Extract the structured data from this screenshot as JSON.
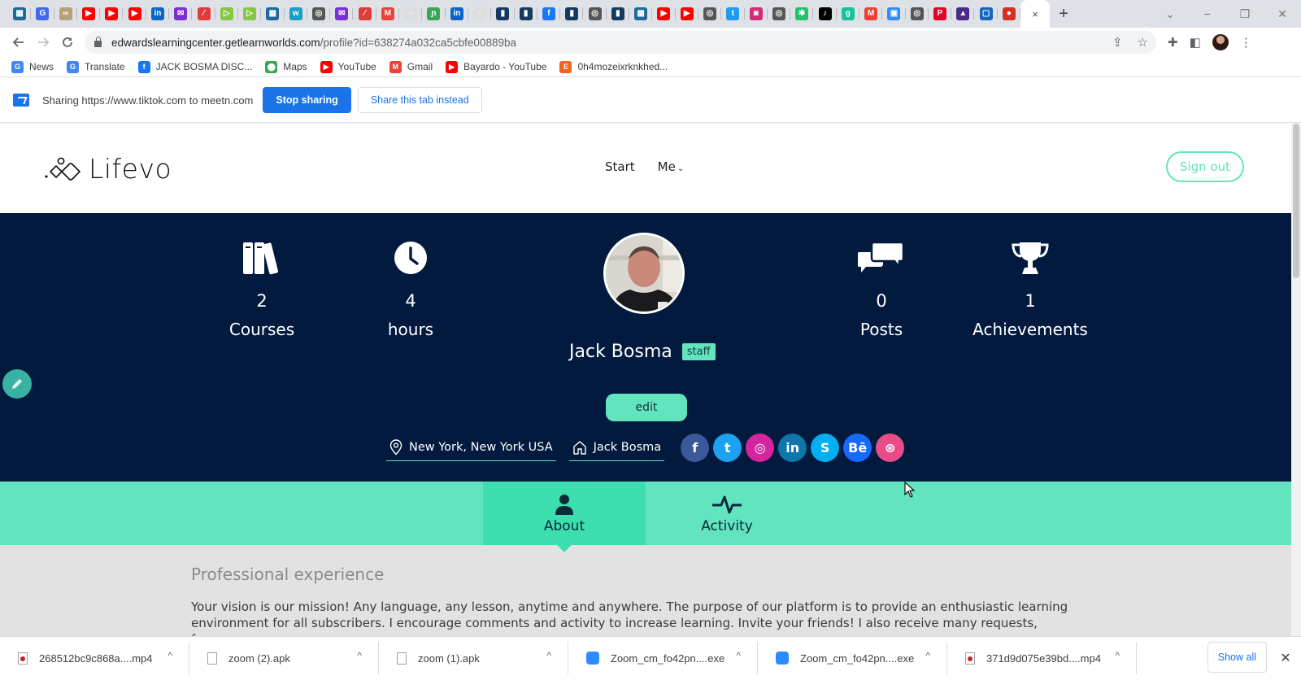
{
  "browser": {
    "tabs": [
      {
        "icon": "meetn-icon",
        "color": "#1a6a9a",
        "glyph": "▦"
      },
      {
        "icon": "google-icon",
        "color": "#4467f0",
        "glyph": "G"
      },
      {
        "icon": "link-icon",
        "color": "#b7a07a",
        "glyph": "∞"
      },
      {
        "icon": "youtube-icon",
        "color": "#ff0000",
        "glyph": "▶"
      },
      {
        "icon": "youtube-icon",
        "color": "#ff0000",
        "glyph": "▶"
      },
      {
        "icon": "youtube-icon",
        "color": "#ff0000",
        "glyph": "▶"
      },
      {
        "icon": "linkedin-icon",
        "color": "#0a66c2",
        "glyph": "in"
      },
      {
        "icon": "mail-icon",
        "color": "#7b2fd0",
        "glyph": "✉"
      },
      {
        "icon": "pen-icon",
        "color": "#e03a3a",
        "glyph": "⁄"
      },
      {
        "icon": "rumble-icon",
        "color": "#85c742",
        "glyph": "▷"
      },
      {
        "icon": "rumble-icon",
        "color": "#85c742",
        "glyph": "▷"
      },
      {
        "icon": "meetn-icon",
        "color": "#1a6a9a",
        "glyph": "▦"
      },
      {
        "icon": "w-icon",
        "color": "#17a0c4",
        "glyph": "w"
      },
      {
        "icon": "chrome-icon",
        "color": "#555555",
        "glyph": "◎"
      },
      {
        "icon": "mail-icon",
        "color": "#7b2fd0",
        "glyph": "✉"
      },
      {
        "icon": "pen-icon",
        "color": "#e03a3a",
        "glyph": "⁄"
      },
      {
        "icon": "gmail-icon",
        "color": "#ea4335",
        "glyph": "M"
      },
      {
        "icon": "blank-icon",
        "color": "#dddddd",
        "glyph": "○"
      },
      {
        "icon": "stripe-icon",
        "color": "#3aa757",
        "glyph": "ɲ"
      },
      {
        "icon": "linkedin-icon",
        "color": "#0a66c2",
        "glyph": "in"
      },
      {
        "icon": "blank-icon",
        "color": "#dddddd",
        "glyph": "○"
      },
      {
        "icon": "dark-app-icon",
        "color": "#163a5f",
        "glyph": "▮"
      },
      {
        "icon": "dark-app-icon",
        "color": "#163a5f",
        "glyph": "▮"
      },
      {
        "icon": "facebook-icon",
        "color": "#1877f2",
        "glyph": "f"
      },
      {
        "icon": "dark-app-icon",
        "color": "#163a5f",
        "glyph": "▮"
      },
      {
        "icon": "chrome-icon",
        "color": "#555555",
        "glyph": "◎"
      },
      {
        "icon": "dark-app-icon",
        "color": "#163a5f",
        "glyph": "▮"
      },
      {
        "icon": "meetn-icon",
        "color": "#1a6a9a",
        "glyph": "▦"
      },
      {
        "icon": "youtube-icon",
        "color": "#ff0000",
        "glyph": "▶"
      },
      {
        "icon": "youtube-icon",
        "color": "#ff0000",
        "glyph": "▶"
      },
      {
        "icon": "chrome-icon",
        "color": "#555555",
        "glyph": "◎"
      },
      {
        "icon": "twitter-icon",
        "color": "#1d9bf0",
        "glyph": "t"
      },
      {
        "icon": "instagram-icon",
        "color": "#d62976",
        "glyph": "◙"
      },
      {
        "icon": "chrome-icon",
        "color": "#555555",
        "glyph": "◎"
      },
      {
        "icon": "asterisk-icon",
        "color": "#23c16b",
        "glyph": "✱"
      },
      {
        "icon": "tiktok-icon",
        "color": "#000000",
        "glyph": "♪"
      },
      {
        "icon": "g-icon",
        "color": "#15c39a",
        "glyph": "g"
      },
      {
        "icon": "gmail-icon",
        "color": "#ea4335",
        "glyph": "M"
      },
      {
        "icon": "zoom-icon",
        "color": "#2d8cff",
        "glyph": "▣"
      },
      {
        "icon": "chrome-icon",
        "color": "#555555",
        "glyph": "◎"
      },
      {
        "icon": "pinterest-icon",
        "color": "#e60023",
        "glyph": "P"
      },
      {
        "icon": "chart-app-icon",
        "color": "#4b2a8a",
        "glyph": "▲"
      },
      {
        "icon": "window-icon",
        "color": "#1565c0",
        "glyph": "▢"
      },
      {
        "icon": "record-icon",
        "color": "#d93025",
        "glyph": "●"
      }
    ],
    "active_tab_close": "×",
    "new_tab": "+",
    "window_controls": {
      "tab_search": "⌄",
      "minimize": "−",
      "restore": "❐",
      "close": "✕"
    },
    "address": {
      "host": "edwardslearningcenter.getlearnworlds.com",
      "path": "/profile?id=638274a032ca5cbfe00889ba"
    },
    "bookmarks": [
      {
        "label": "News",
        "icon": "google-news-icon",
        "color": "#4285f4",
        "glyph": "G"
      },
      {
        "label": "Translate",
        "icon": "google-translate-icon",
        "color": "#4285f4",
        "glyph": "G"
      },
      {
        "label": "JACK BOSMA DISC...",
        "icon": "facebook-icon",
        "color": "#1877f2",
        "glyph": "f"
      },
      {
        "label": "Maps",
        "icon": "maps-icon",
        "color": "#34a853",
        "glyph": "⬤"
      },
      {
        "label": "YouTube",
        "icon": "youtube-icon",
        "color": "#ff0000",
        "glyph": "▶"
      },
      {
        "label": "Gmail",
        "icon": "gmail-icon",
        "color": "#ea4335",
        "glyph": "M"
      },
      {
        "label": "Bayardo - YouTube",
        "icon": "youtube-icon",
        "color": "#ff0000",
        "glyph": "▶"
      },
      {
        "label": "0h4mozeixrknkhed...",
        "icon": "etsy-icon",
        "color": "#f1641e",
        "glyph": "E"
      }
    ],
    "sharing": {
      "text": "Sharing https://www.tiktok.com to meetn.com",
      "stop_label": "Stop sharing",
      "share_tab_label": "Share this tab instead"
    }
  },
  "site": {
    "logo_text": "Lifevo",
    "nav": {
      "start": "Start",
      "me": "Me"
    },
    "sign_out": "Sign out",
    "colors": {
      "accent": "#62e4be",
      "accent_dark": "#3ddfae",
      "hero_bg": "#021a3e"
    }
  },
  "profile": {
    "stats": [
      {
        "icon": "books-icon",
        "value": "2",
        "label": "Courses"
      },
      {
        "icon": "clock-icon",
        "value": "4",
        "label": "hours"
      },
      {
        "icon": "comments-icon",
        "value": "0",
        "label": "Posts"
      },
      {
        "icon": "trophy-icon",
        "value": "1",
        "label": "Achievements"
      }
    ],
    "name": "Jack Bosma",
    "badge": "staff",
    "edit_label": "edit",
    "location": "New York, New York USA",
    "home": "Jack Bosma",
    "socials": [
      {
        "name": "facebook",
        "color": "#3b5998",
        "glyph": "f"
      },
      {
        "name": "twitter",
        "color": "#1da1f2",
        "glyph": "t"
      },
      {
        "name": "instagram",
        "color": "#d6249f",
        "glyph": "◎"
      },
      {
        "name": "linkedin",
        "color": "#0e76a8",
        "glyph": "in"
      },
      {
        "name": "skype",
        "color": "#00aff0",
        "glyph": "S"
      },
      {
        "name": "behance",
        "color": "#1769ff",
        "glyph": "Bē"
      },
      {
        "name": "dribbble",
        "color": "#ea4c89",
        "glyph": "⊛"
      }
    ],
    "tabs": [
      {
        "label": "About",
        "icon": "user-icon",
        "active": true
      },
      {
        "label": "Activity",
        "icon": "activity-icon",
        "active": false
      }
    ],
    "section_title": "Professional experience",
    "section_body": "Your vision is our mission! Any language, any lesson, anytime and anywhere. The purpose of our platform is to provide an enthusiastic learning environment for all subscribers. I encourage comments and activity to increase learning. Invite your friends! I also receive many requests, from"
  },
  "downloads": {
    "items": [
      {
        "name": "268512bc9c868a....mp4",
        "type": "mp4"
      },
      {
        "name": "zoom (2).apk",
        "type": "file"
      },
      {
        "name": "zoom (1).apk",
        "type": "file"
      },
      {
        "name": "Zoom_cm_fo42pn....exe",
        "type": "zoom"
      },
      {
        "name": "Zoom_cm_fo42pn....exe",
        "type": "zoom"
      },
      {
        "name": "371d9d075e39bd....mp4",
        "type": "mp4"
      }
    ],
    "chevron": "^",
    "show_all": "Show all",
    "close": "✕"
  }
}
